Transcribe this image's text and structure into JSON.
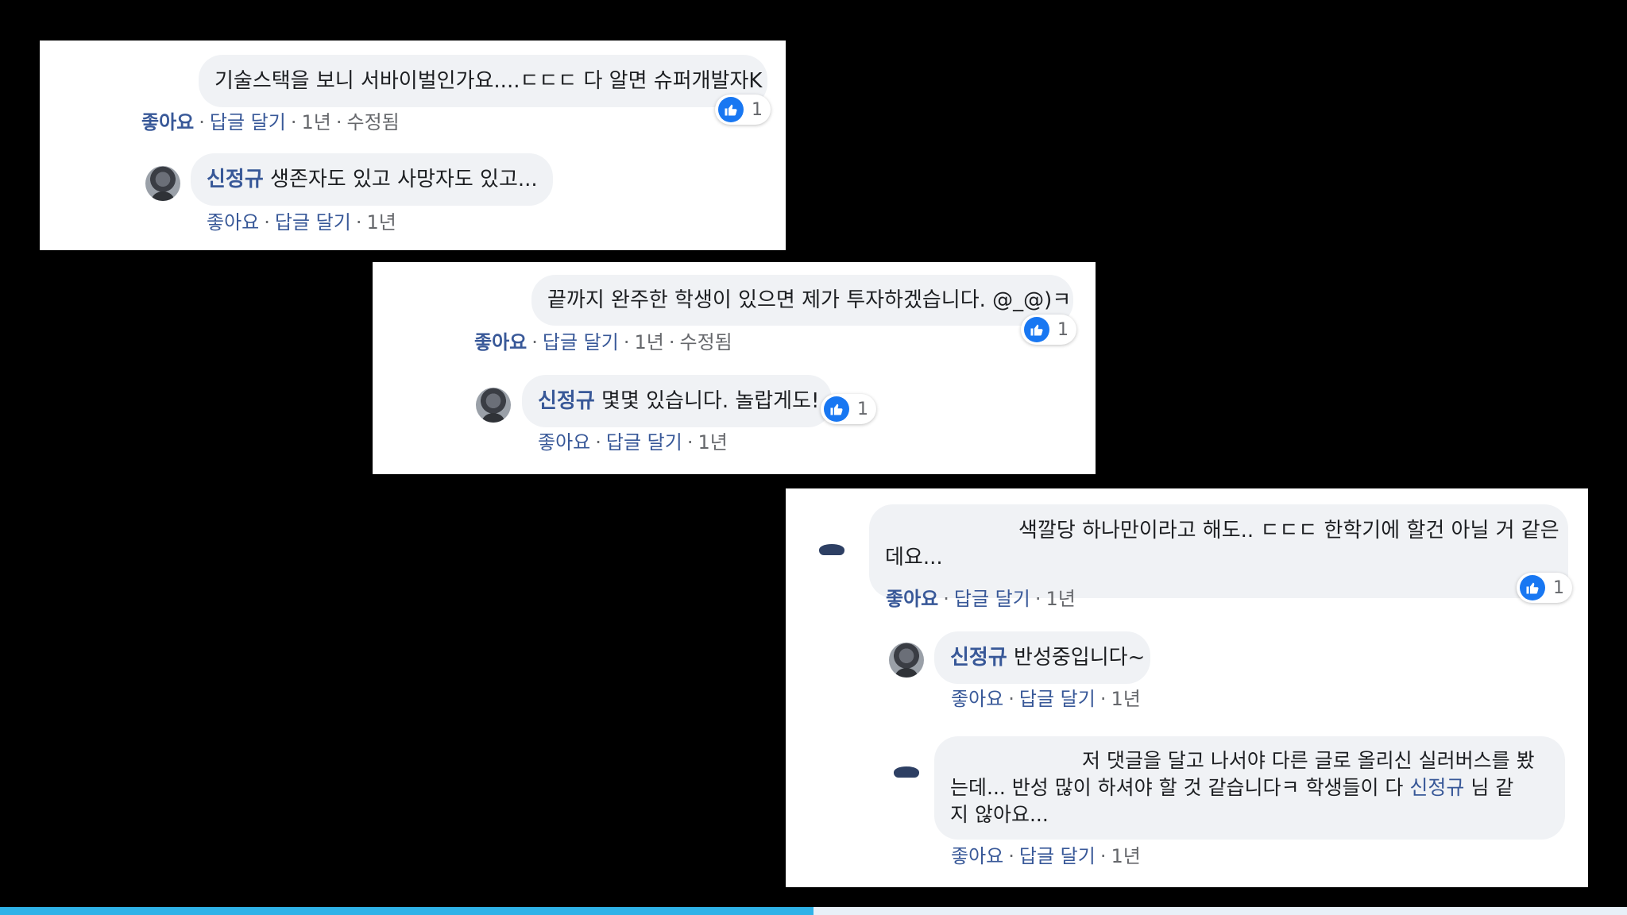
{
  "thread1": {
    "comment": {
      "text": "기술스택을 보니 서바이벌인가요....ㄷㄷㄷ 다 알면 슈퍼개발자K",
      "reaction_count": "1",
      "like": "좋아요",
      "reply": "답글 달기",
      "time": "1년",
      "edited": "수정됨"
    },
    "reply": {
      "author": "신정규",
      "text": "생존자도 있고 사망자도 있고...",
      "like": "좋아요",
      "reply": "답글 달기",
      "time": "1년"
    }
  },
  "thread2": {
    "comment": {
      "text": "끝까지 완주한 학생이 있으면 제가 투자하겠습니다. @_@)ㅋ",
      "reaction_count": "1",
      "like": "좋아요",
      "reply": "답글 달기",
      "time": "1년",
      "edited": "수정됨"
    },
    "reply": {
      "author": "신정규",
      "text": "몇몇 있습니다. 놀랍게도!",
      "reaction_count": "1",
      "like": "좋아요",
      "reply": "답글 달기",
      "time": "1년"
    }
  },
  "thread3": {
    "comment": {
      "text_line1": "색깔당 하나만이라고 해도.. ㄷㄷㄷ 한학기에 할건 아닐 거 같은",
      "text_line2": "데요...",
      "reaction_count": "1",
      "like": "좋아요",
      "reply": "답글 달기",
      "time": "1년"
    },
    "reply1": {
      "author": "신정규",
      "text": "반성중입니다~",
      "like": "좋아요",
      "reply": "답글 달기",
      "time": "1년"
    },
    "reply2": {
      "text_line1": "저 댓글을 달고 나서야 다른 글로 올리신 실러버스를 봤",
      "text_line2_a": "는데... 반성 많이 하셔야 할 것 같습니다ㅋ 학생들이 다 ",
      "mention": "신정규",
      "text_line2_b": " 님 같",
      "text_line3": "지 않아요...",
      "like": "좋아요",
      "reply": "답글 달기",
      "time": "1년"
    }
  },
  "video_progress": 0.5,
  "colors": {
    "link": "#385898",
    "like": "#1877f2",
    "bubble": "#f0f2f5",
    "progress": "#2fb2e8"
  }
}
